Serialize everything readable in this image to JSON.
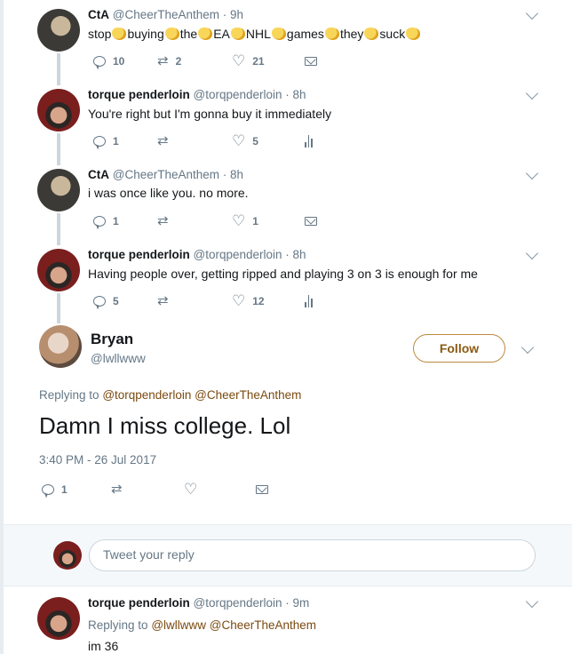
{
  "tweets": [
    {
      "name": "CtA",
      "handle": "@CheerTheAnthem · 9h",
      "words": [
        "stop",
        "buying",
        "the",
        "EA",
        "NHL",
        "games",
        "they",
        "suck"
      ],
      "replies": "10",
      "retweets": "2",
      "likes": "21"
    },
    {
      "name": "torque penderloin",
      "handle": "@torqpenderloin · 8h",
      "text": "You're right but I'm gonna buy it immediately",
      "replies": "1",
      "retweets": "",
      "likes": "5"
    },
    {
      "name": "CtA",
      "handle": "@CheerTheAnthem · 8h",
      "text": "i was once like you. no more.",
      "replies": "1",
      "retweets": "",
      "likes": "1"
    },
    {
      "name": "torque penderloin",
      "handle": "@torqpenderloin · 8h",
      "text": "Having people over, getting ripped and playing 3 on 3 is enough for me",
      "replies": "5",
      "retweets": "",
      "likes": "12"
    }
  ],
  "main_tweet": {
    "name": "Bryan",
    "handle": "@lwllwww",
    "follow_label": "Follow",
    "replying_prefix": "Replying to",
    "mention1": "@torqpenderloin",
    "mention2": "@CheerTheAnthem",
    "text": "Damn I miss college. Lol",
    "timestamp": "3:40 PM - 26 Jul 2017",
    "replies": "1"
  },
  "reply_box": {
    "placeholder": "Tweet your reply"
  },
  "last_tweet": {
    "name": "torque penderloin",
    "handle": "@torqpenderloin · 9m",
    "replying_prefix": "Replying to",
    "mention1": "@lwllwww",
    "mention2": "@CheerTheAnthem",
    "text": "im 36"
  },
  "colors": {
    "accent": "#bb8a40",
    "mention": "#7a4a10",
    "muted": "#657786"
  }
}
